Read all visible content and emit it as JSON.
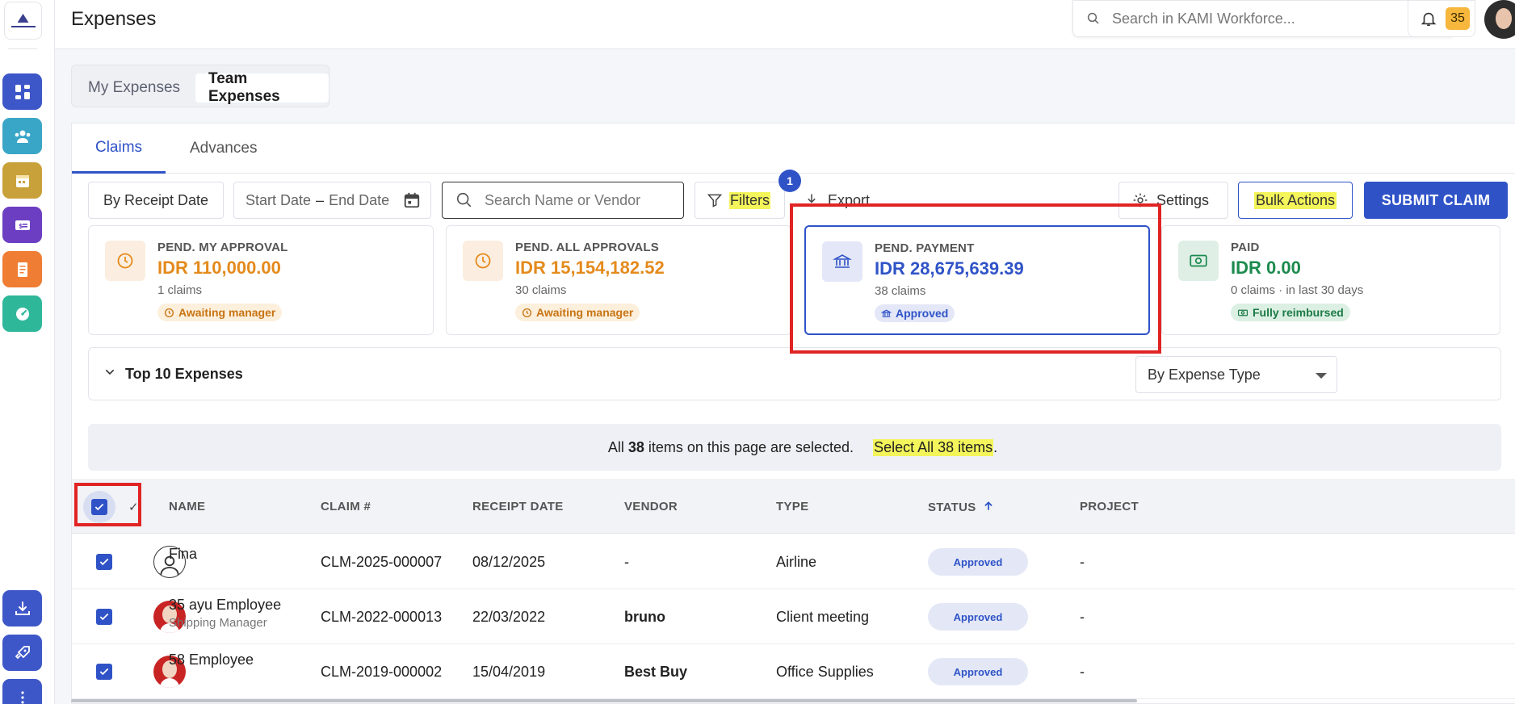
{
  "app": {
    "title": "Expenses"
  },
  "search": {
    "placeholder": "Search in KAMI Workforce..."
  },
  "notifications": {
    "count": "35"
  },
  "rail": {
    "items": [
      {
        "icon": "dashboard-icon",
        "color": "#3e57c8"
      },
      {
        "icon": "people-icon",
        "color": "#3aa6c7"
      },
      {
        "icon": "calendar-icon",
        "color": "#c9a13a"
      },
      {
        "icon": "money-card-icon",
        "color": "#6c3fc2"
      },
      {
        "icon": "document-icon",
        "color": "#f07d34"
      },
      {
        "icon": "gauge-icon",
        "color": "#2fb79a"
      },
      {
        "icon": "download-icon",
        "color": "#3e57c8"
      },
      {
        "icon": "rocket-icon",
        "color": "#3e57c8"
      },
      {
        "icon": "more-icon",
        "color": "#3e57c8"
      }
    ]
  },
  "view_toggle": {
    "my": "My Expenses",
    "team": "Team Expenses"
  },
  "tabs": {
    "claims": "Claims",
    "advances": "Advances"
  },
  "toolbar": {
    "date_type": "By Receipt Date",
    "start_date": "Start Date",
    "dash": "–",
    "end_date": "End Date",
    "search_placeholder": "Search Name or Vendor",
    "filters": "Filters",
    "filter_count": "1",
    "export": "Export",
    "settings": "Settings",
    "bulk_actions": "Bulk Actions",
    "submit_claim": "SUBMIT CLAIM"
  },
  "summary_cards": [
    {
      "title": "PEND. MY APPROVAL",
      "value": "IDR 110,000.00",
      "sub": "1 claims",
      "badge": "Awaiting manager"
    },
    {
      "title": "PEND. ALL APPROVALS",
      "value": "IDR 15,154,182.52",
      "sub": "30 claims",
      "badge": "Awaiting manager"
    },
    {
      "title": "PEND. PAYMENT",
      "value": "IDR 28,675,639.39",
      "sub": "38 claims",
      "badge": "Approved"
    },
    {
      "title": "PAID",
      "value": "IDR 0.00",
      "sub": "0 claims · in last 30 days",
      "badge": "Fully reimbursed"
    }
  ],
  "top10": {
    "label": "Top 10 Expenses",
    "group_by": "By Expense Type"
  },
  "selection": {
    "prefix": "All",
    "count": "38",
    "suffix": "items on this page are selected.",
    "select_all": "Select All 38 items",
    "period": "."
  },
  "table": {
    "header_check": "✓",
    "columns": [
      "NAME",
      "CLAIM #",
      "RECEIPT DATE",
      "VENDOR",
      "TYPE",
      "STATUS",
      "PROJECT"
    ],
    "rows": [
      {
        "name": "Fina",
        "subtitle": "",
        "claim": "CLM-2025-000007",
        "date": "08/12/2025",
        "vendor": "-",
        "type": "Airline",
        "status": "Approved",
        "project": "-"
      },
      {
        "name": "35 ayu Employee",
        "subtitle": "Shipping Manager",
        "claim": "CLM-2022-000013",
        "date": "22/03/2022",
        "vendor": "bruno",
        "type": "Client meeting",
        "status": "Approved",
        "project": "-"
      },
      {
        "name": "58 Employee",
        "subtitle": "",
        "claim": "CLM-2019-000002",
        "date": "15/04/2019",
        "vendor": "Best Buy",
        "type": "Office Supplies",
        "status": "Approved",
        "project": "-"
      }
    ]
  },
  "colors": {
    "accent": "#2f53c7",
    "highlight": "#f3f55a",
    "annotation": "#e02424"
  }
}
